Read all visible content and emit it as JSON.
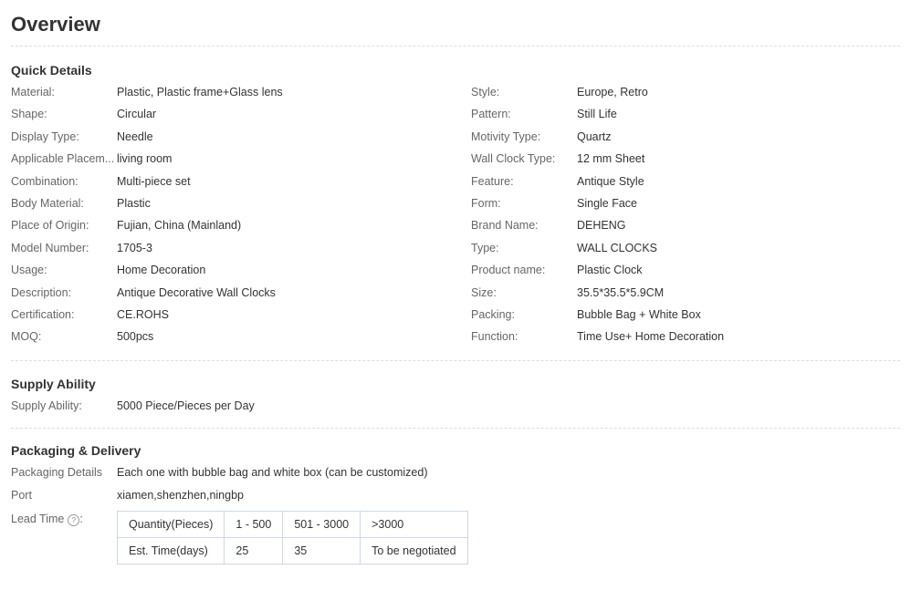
{
  "title": "Overview",
  "quick_details": {
    "title": "Quick Details",
    "left": [
      {
        "label": "Material:",
        "value": "Plastic, Plastic frame+Glass lens"
      },
      {
        "label": "Shape:",
        "value": "Circular"
      },
      {
        "label": "Display Type:",
        "value": "Needle"
      },
      {
        "label": "Applicable Placem...",
        "value": "living room"
      },
      {
        "label": "Combination:",
        "value": "Multi-piece set"
      },
      {
        "label": "Body Material:",
        "value": "Plastic"
      },
      {
        "label": "Place of Origin:",
        "value": "Fujian, China (Mainland)"
      },
      {
        "label": "Model Number:",
        "value": "1705-3"
      },
      {
        "label": "Usage:",
        "value": "Home Decoration"
      },
      {
        "label": "Description:",
        "value": "Antique Decorative Wall Clocks"
      },
      {
        "label": "Certification:",
        "value": "CE.ROHS"
      },
      {
        "label": "MOQ:",
        "value": "500pcs"
      }
    ],
    "right": [
      {
        "label": "Style:",
        "value": "Europe, Retro"
      },
      {
        "label": "Pattern:",
        "value": "Still Life"
      },
      {
        "label": "Motivity Type:",
        "value": "Quartz"
      },
      {
        "label": "Wall Clock Type:",
        "value": "12 mm Sheet"
      },
      {
        "label": "Feature:",
        "value": "Antique Style"
      },
      {
        "label": "Form:",
        "value": "Single Face"
      },
      {
        "label": "Brand Name:",
        "value": "DEHENG"
      },
      {
        "label": "Type:",
        "value": "WALL CLOCKS"
      },
      {
        "label": "Product name:",
        "value": "Plastic Clock"
      },
      {
        "label": "Size:",
        "value": "35.5*35.5*5.9CM"
      },
      {
        "label": "Packing:",
        "value": "Bubble Bag + White Box"
      },
      {
        "label": "Function:",
        "value": "Time Use+ Home Decoration"
      }
    ]
  },
  "supply": {
    "title": "Supply Ability",
    "label": "Supply Ability:",
    "value": "5000 Piece/Pieces per Day"
  },
  "packaging": {
    "title": "Packaging & Delivery",
    "details_label": "Packaging Details",
    "details_value": "Each one with bubble bag and white box (can be customized)",
    "port_label": "Port",
    "port_value": "xiamen,shenzhen,ningbp",
    "lead_label": "Lead Time",
    "lead_icon": "?",
    "lead_table": {
      "rows": [
        [
          "Quantity(Pieces)",
          "1 - 500",
          "501 - 3000",
          ">3000"
        ],
        [
          "Est. Time(days)",
          "25",
          "35",
          "To be negotiated"
        ]
      ]
    }
  }
}
